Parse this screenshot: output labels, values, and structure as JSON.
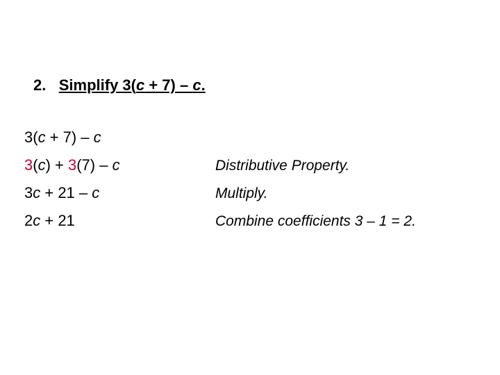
{
  "problem": {
    "number": "2.",
    "verb": "Simplify ",
    "open": "3(",
    "var1": "c",
    "mid": " + 7) – ",
    "var2": "c",
    "end": "."
  },
  "steps": [
    {
      "segments": [
        {
          "t": "3(",
          "cls": ""
        },
        {
          "t": "c",
          "cls": "it"
        },
        {
          "t": " + 7) – ",
          "cls": ""
        },
        {
          "t": "c",
          "cls": "it"
        }
      ],
      "reason": ""
    },
    {
      "segments": [
        {
          "t": "3",
          "cls": "red3"
        },
        {
          "t": "(",
          "cls": ""
        },
        {
          "t": "c",
          "cls": "it"
        },
        {
          "t": ") + ",
          "cls": ""
        },
        {
          "t": "3",
          "cls": "red3"
        },
        {
          "t": "(7) – ",
          "cls": ""
        },
        {
          "t": "c",
          "cls": "it"
        }
      ],
      "reason": "Distributive Property."
    },
    {
      "segments": [
        {
          "t": "3",
          "cls": ""
        },
        {
          "t": "c",
          "cls": "it"
        },
        {
          "t": " + 21 – ",
          "cls": ""
        },
        {
          "t": "c",
          "cls": "it"
        }
      ],
      "reason": "Multiply."
    },
    {
      "segments": [
        {
          "t": "2",
          "cls": ""
        },
        {
          "t": "c",
          "cls": "it"
        },
        {
          "t": " + 21",
          "cls": ""
        }
      ],
      "reason": "Combine coefficients 3 – 1 = 2."
    }
  ]
}
